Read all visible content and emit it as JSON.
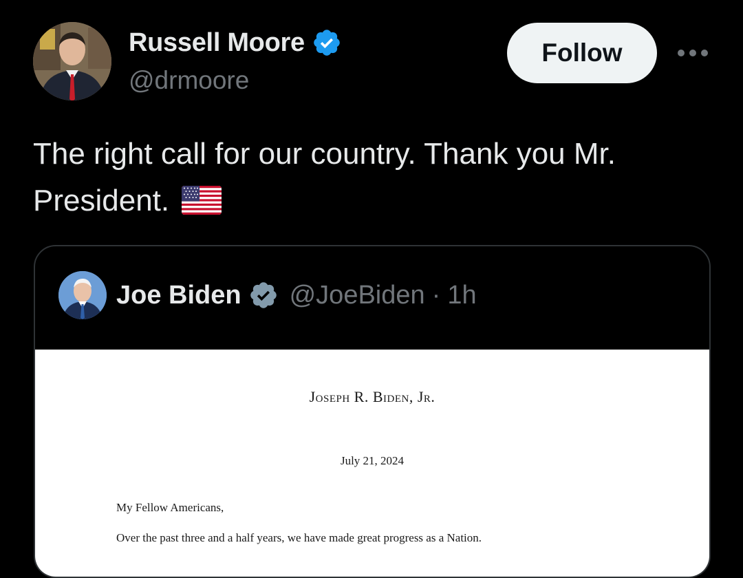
{
  "tweet": {
    "author": {
      "name": "Russell Moore",
      "handle": "@drmoore",
      "verified": true
    },
    "follow_label": "Follow",
    "more_icon": "more-horizontal-icon",
    "text": "The right call for our country. Thank you Mr. President.",
    "emoji": "us-flag"
  },
  "quote": {
    "author": {
      "name": "Joe Biden",
      "handle": "@JoeBiden",
      "verified": true
    },
    "separator": "·",
    "time": "1h",
    "letter": {
      "heading": "Joseph R. Biden, Jr.",
      "date": "July 21, 2024",
      "salutation": "My Fellow Americans,",
      "paragraph": "Over the past three and a half years, we have made great progress as a Nation."
    }
  },
  "colors": {
    "background": "#000000",
    "text_primary": "#e7e9ea",
    "text_secondary": "#71767b",
    "verified_blue": "#1d9bf0",
    "verified_gray": "#829aab",
    "follow_bg": "#eff3f4",
    "border": "#2f3336"
  }
}
